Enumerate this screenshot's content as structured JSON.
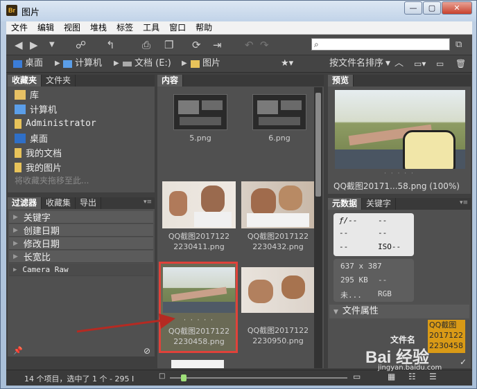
{
  "window": {
    "title": "图片",
    "app_icon": "Br",
    "minimize": "—",
    "maximize": "▢",
    "close": "✕"
  },
  "menu": [
    "文件",
    "编辑",
    "视图",
    "堆栈",
    "标签",
    "工具",
    "窗口",
    "帮助"
  ],
  "search": {
    "placeholder": ""
  },
  "path": {
    "items": [
      "桌面",
      "计算机",
      "文档 (E:)",
      "图片"
    ],
    "sort_label": "按文件名排序"
  },
  "favorites": {
    "tabs": [
      "收藏夹",
      "文件夹"
    ],
    "items": [
      "库",
      "计算机",
      "Administrator",
      "桌面",
      "我的文档",
      "我的图片"
    ],
    "hint": "将收藏夹拖移至此..."
  },
  "filter": {
    "tabs": [
      "过滤器",
      "收藏集",
      "导出"
    ],
    "rows": [
      "关键字",
      "创建日期",
      "修改日期",
      "长宽比",
      "Camera Raw"
    ]
  },
  "content": {
    "tab": "内容",
    "items": [
      {
        "label1": "5.png",
        "label2": ""
      },
      {
        "label1": "6.png",
        "label2": ""
      },
      {
        "label1": "QQ截图2017122",
        "label2": "2230411.png"
      },
      {
        "label1": "QQ截图2017122",
        "label2": "2230432.png"
      },
      {
        "label1": "QQ截图2017122",
        "label2": "2230458.png"
      },
      {
        "label1": "QQ截图2017122",
        "label2": "2230950.png"
      }
    ],
    "dots": "· · · · ·"
  },
  "preview": {
    "tab": "预览",
    "caption": "QQ截图20171...58.png (100%)"
  },
  "metadata": {
    "tabs": [
      "元数据",
      "关键字"
    ],
    "camera": {
      "f": "ƒ/--",
      "a": "--",
      "b": "--",
      "c": "--",
      "d": "--",
      "e": "--",
      "iso": "ISO--"
    },
    "info": {
      "dims": "637 x 387",
      "size": "295 KB",
      "size_extra": "--",
      "profile": "未...",
      "mode": "RGB"
    },
    "section": "文件属性",
    "field_label": "文件名",
    "field_value": [
      "QQ截图",
      "2017122",
      "2230458"
    ]
  },
  "status": {
    "text": "14 个项目，选中了 1 个 - 295 I"
  },
  "watermark": {
    "brand": "Bai 经验",
    "url": "jingyan.baidu.com"
  },
  "colors": {
    "selection": "#e0423a",
    "field_highlight": "#d99a16",
    "arrow": "#b52a22"
  }
}
